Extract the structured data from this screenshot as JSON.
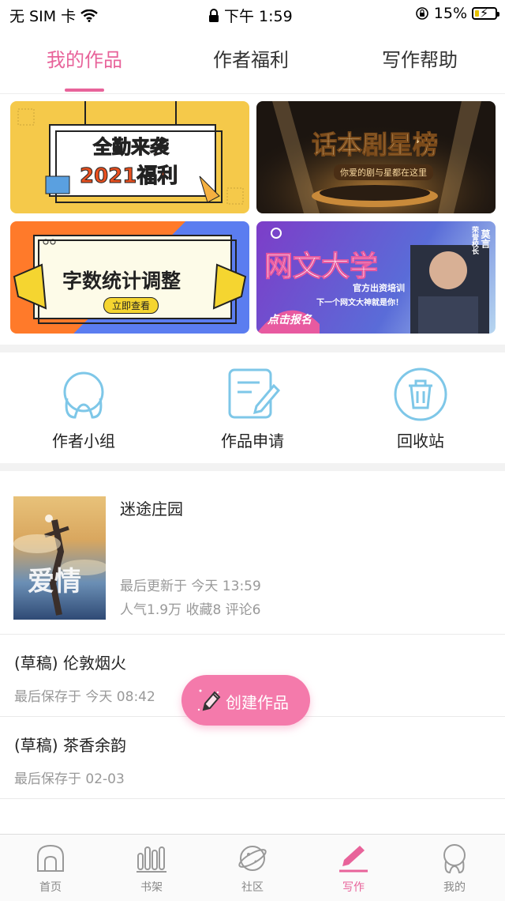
{
  "status_bar": {
    "carrier": "无 SIM 卡",
    "time": "下午 1:59",
    "battery": "15%"
  },
  "tabs": [
    {
      "label": "我的作品",
      "active": true
    },
    {
      "label": "作者福利",
      "active": false
    },
    {
      "label": "写作帮助",
      "active": false
    }
  ],
  "banners": {
    "b1": {
      "line1": "全勤来袭",
      "line2": "2021福利"
    },
    "b2": {
      "title": "话本剧星榜",
      "subtitle": "你爱的剧与星都在这里"
    },
    "b3": {
      "title": "字数统计调整",
      "button": "立即查看"
    },
    "b4": {
      "title": "网文大学",
      "sub1": "官方出资培训",
      "sub2": "下一个网文大神就是你！",
      "cta": "点击报名",
      "name": "莫言",
      "role": "荣誉校长"
    }
  },
  "quick_actions": [
    {
      "label": "作者小组",
      "icon": "author-group-icon"
    },
    {
      "label": "作品申请",
      "icon": "work-apply-icon"
    },
    {
      "label": "回收站",
      "icon": "recycle-bin-icon"
    }
  ],
  "work": {
    "title": "迷途庄园",
    "updated": "最后更新于 今天 13:59",
    "stats": "人气1.9万 收藏8 评论6",
    "cover_text": "爱情"
  },
  "drafts": [
    {
      "title": "(草稿) 伦敦烟火",
      "saved": "最后保存于 今天 08:42"
    },
    {
      "title": "(草稿) 茶香余韵",
      "saved": "最后保存于 02-03"
    }
  ],
  "fab": {
    "label": "创建作品"
  },
  "bottom_nav": [
    {
      "label": "首页",
      "icon": "home-icon",
      "active": false
    },
    {
      "label": "书架",
      "icon": "bookshelf-icon",
      "active": false
    },
    {
      "label": "社区",
      "icon": "community-icon",
      "active": false
    },
    {
      "label": "写作",
      "icon": "write-icon",
      "active": true
    },
    {
      "label": "我的",
      "icon": "profile-icon",
      "active": false
    }
  ],
  "colors": {
    "accent": "#e8639a",
    "fab": "#f47aab",
    "icon_blue": "#7ec7e8"
  }
}
